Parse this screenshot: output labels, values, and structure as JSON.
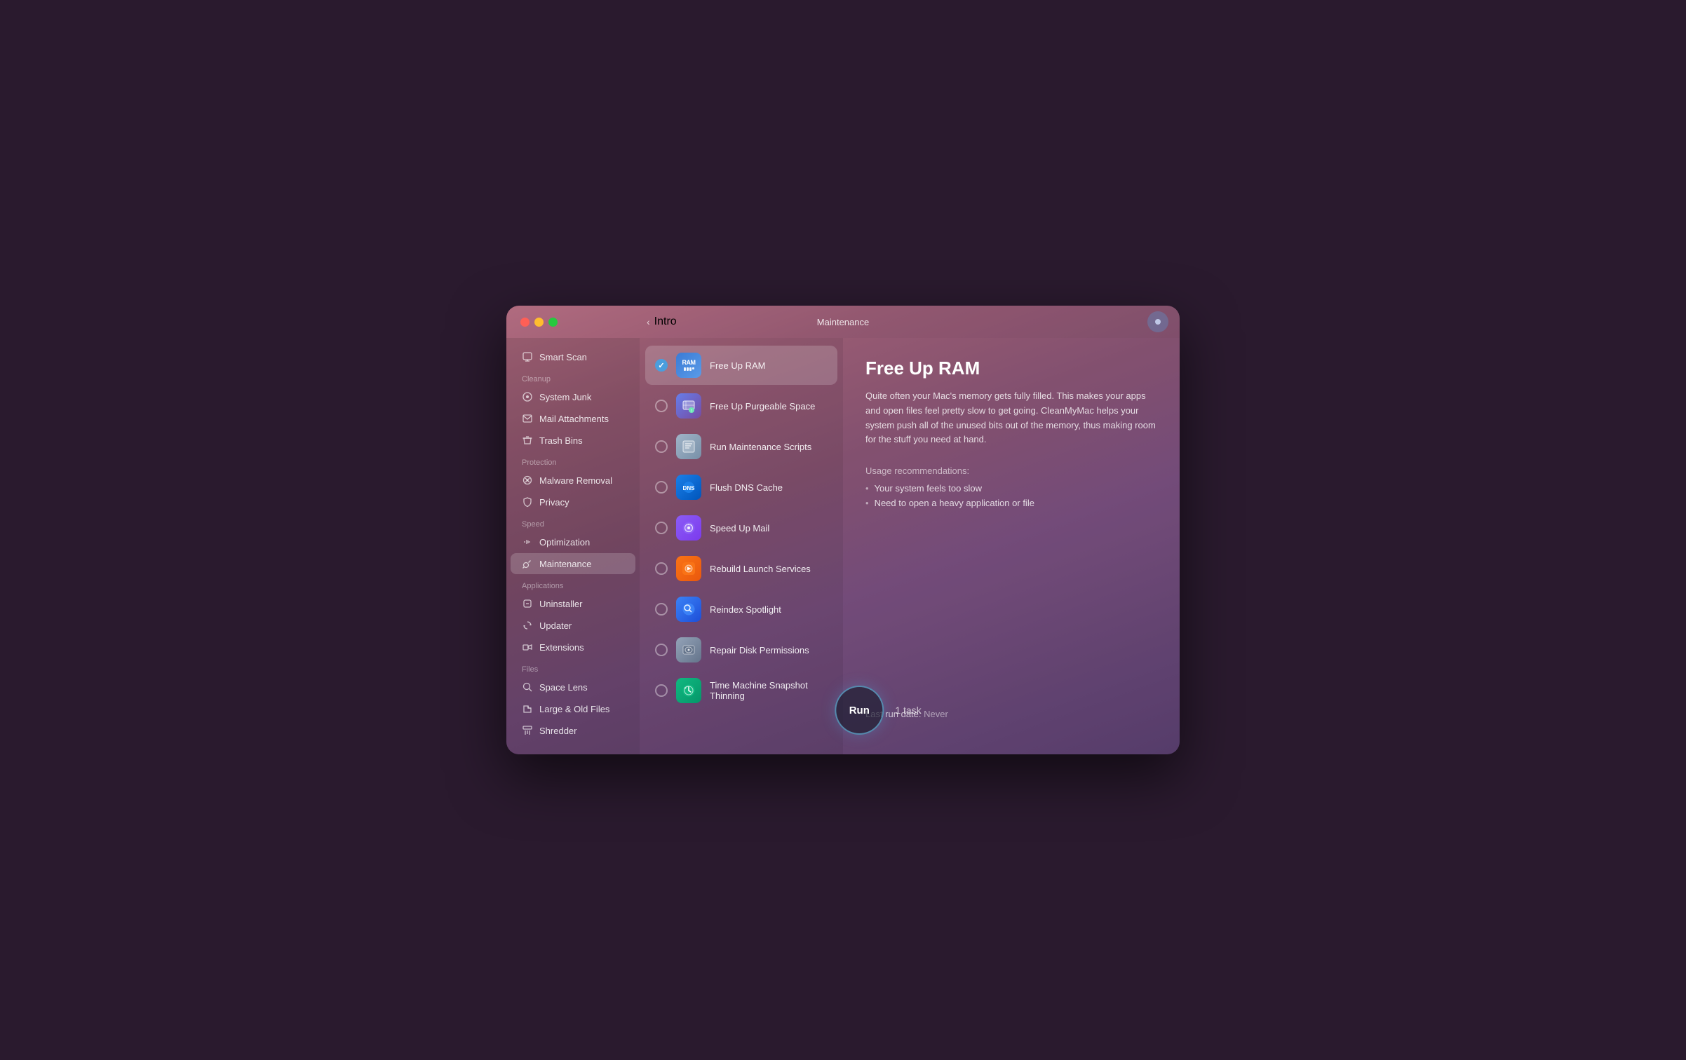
{
  "window": {
    "title": "Maintenance"
  },
  "titlebar": {
    "back_label": "Intro",
    "title": "Maintenance"
  },
  "sidebar": {
    "smart_scan": "Smart Scan",
    "sections": [
      {
        "label": "Cleanup",
        "items": [
          {
            "id": "system-junk",
            "label": "System Junk"
          },
          {
            "id": "mail-attachments",
            "label": "Mail Attachments"
          },
          {
            "id": "trash-bins",
            "label": "Trash Bins"
          }
        ]
      },
      {
        "label": "Protection",
        "items": [
          {
            "id": "malware-removal",
            "label": "Malware Removal"
          },
          {
            "id": "privacy",
            "label": "Privacy"
          }
        ]
      },
      {
        "label": "Speed",
        "items": [
          {
            "id": "optimization",
            "label": "Optimization"
          },
          {
            "id": "maintenance",
            "label": "Maintenance",
            "active": true
          }
        ]
      },
      {
        "label": "Applications",
        "items": [
          {
            "id": "uninstaller",
            "label": "Uninstaller"
          },
          {
            "id": "updater",
            "label": "Updater"
          },
          {
            "id": "extensions",
            "label": "Extensions"
          }
        ]
      },
      {
        "label": "Files",
        "items": [
          {
            "id": "space-lens",
            "label": "Space Lens"
          },
          {
            "id": "large-old-files",
            "label": "Large & Old Files"
          },
          {
            "id": "shredder",
            "label": "Shredder"
          }
        ]
      }
    ]
  },
  "tasks": [
    {
      "id": "free-up-ram",
      "label": "Free Up RAM",
      "selected": true,
      "checked": true,
      "icon_type": "ram"
    },
    {
      "id": "free-up-purgeable",
      "label": "Free Up Purgeable Space",
      "selected": false,
      "checked": false,
      "icon_type": "purgeable"
    },
    {
      "id": "run-maintenance-scripts",
      "label": "Run Maintenance Scripts",
      "selected": false,
      "checked": false,
      "icon_type": "scripts"
    },
    {
      "id": "flush-dns-cache",
      "label": "Flush DNS Cache",
      "selected": false,
      "checked": false,
      "icon_type": "dns"
    },
    {
      "id": "speed-up-mail",
      "label": "Speed Up Mail",
      "selected": false,
      "checked": false,
      "icon_type": "mail"
    },
    {
      "id": "rebuild-launch-services",
      "label": "Rebuild Launch Services",
      "selected": false,
      "checked": false,
      "icon_type": "launch"
    },
    {
      "id": "reindex-spotlight",
      "label": "Reindex Spotlight",
      "selected": false,
      "checked": false,
      "icon_type": "spotlight"
    },
    {
      "id": "repair-disk-permissions",
      "label": "Repair Disk Permissions",
      "selected": false,
      "checked": false,
      "icon_type": "disk"
    },
    {
      "id": "time-machine-thinning",
      "label": "Time Machine Snapshot Thinning",
      "selected": false,
      "checked": false,
      "icon_type": "timemachine"
    }
  ],
  "detail": {
    "title": "Free Up RAM",
    "description": "Quite often your Mac's memory gets fully filled. This makes your apps and open files feel pretty slow to get going. CleanMyMac helps your system push all of the unused bits out of the memory, thus making room for the stuff you need at hand.",
    "usage_label": "Usage recommendations:",
    "usage_items": [
      "Your system feels too slow",
      "Need to open a heavy application or file"
    ],
    "last_run_label": "Last run date:",
    "last_run_value": "Never"
  },
  "run_button": {
    "label": "Run",
    "task_count": "1 task"
  }
}
